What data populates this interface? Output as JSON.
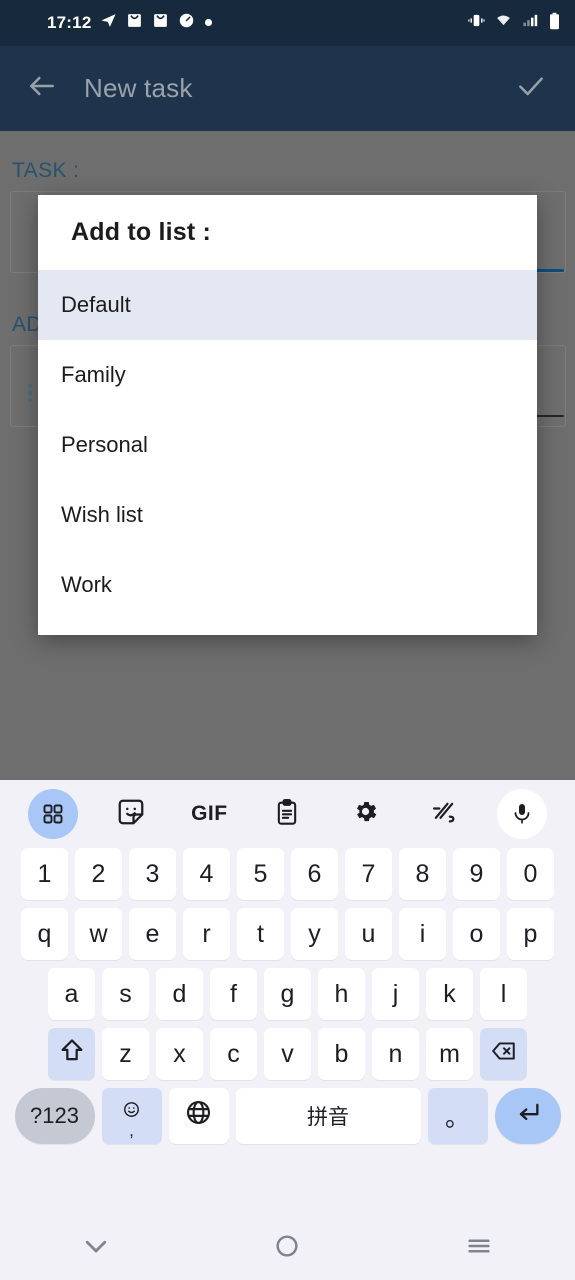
{
  "status_bar": {
    "time": "17:12",
    "left_icons": [
      "telegram-icon",
      "mail-icon",
      "mail-icon",
      "speedometer-icon",
      "dot-icon"
    ],
    "right_icons": [
      "vibrate-icon",
      "wifi-icon",
      "signal-icon",
      "battery-icon"
    ],
    "background": "#17293d"
  },
  "toolbar": {
    "back_icon": "arrow-left-icon",
    "title": "New task",
    "confirm_icon": "check-icon",
    "background": "#1e344c",
    "title_color": "#9aa3ab"
  },
  "app_body": {
    "task_label": "TASK :",
    "add_to_list_label": "AD",
    "label_color": "#28526f",
    "fab": {
      "icon": "alarm-add-icon",
      "color": "#8c2b2b"
    },
    "scrim_color": "#6e6e6e"
  },
  "dialog": {
    "title": "Add to list :",
    "selected": "Default",
    "highlight_color": "#e3e8f2",
    "items": [
      {
        "label": "Default",
        "selected": true
      },
      {
        "label": "Family",
        "selected": false
      },
      {
        "label": "Personal",
        "selected": false
      },
      {
        "label": "Wish list",
        "selected": false
      },
      {
        "label": "Work",
        "selected": false
      }
    ]
  },
  "keyboard": {
    "toolbar_icons": [
      {
        "name": "apps-grid-icon",
        "style": "blue-circle"
      },
      {
        "name": "sticker-icon",
        "style": "plain"
      },
      {
        "name": "gif-icon",
        "style": "text",
        "label": "GIF"
      },
      {
        "name": "clipboard-icon",
        "style": "plain"
      },
      {
        "name": "gear-icon",
        "style": "plain"
      },
      {
        "name": "handwriting-icon",
        "style": "plain"
      },
      {
        "name": "microphone-icon",
        "style": "white-circle"
      }
    ],
    "row_numbers": [
      "1",
      "2",
      "3",
      "4",
      "5",
      "6",
      "7",
      "8",
      "9",
      "0"
    ],
    "row_q": [
      "q",
      "w",
      "e",
      "r",
      "t",
      "y",
      "u",
      "i",
      "o",
      "p"
    ],
    "row_a": [
      "a",
      "s",
      "d",
      "f",
      "g",
      "h",
      "j",
      "k",
      "l"
    ],
    "row_z": [
      "z",
      "x",
      "c",
      "v",
      "b",
      "n",
      "m"
    ],
    "shift_icon": "shift-up-icon",
    "backspace_icon": "backspace-icon",
    "symbols_label": "?123",
    "emoji_icon": "emoji-icon",
    "comma_label": ",",
    "globe_icon": "globe-icon",
    "space_label": "拼音",
    "period_label": "。",
    "enter_icon": "enter-return-icon",
    "key_color": "#ffffff",
    "func_key_color": "#d3ddf6",
    "background": "#f1f1f7"
  },
  "nav_bar": {
    "back_icon": "chevron-down-icon",
    "home_icon": "circle-home-icon",
    "recents_icon": "hamburger-recents-icon",
    "background": "#f1f1f7"
  }
}
